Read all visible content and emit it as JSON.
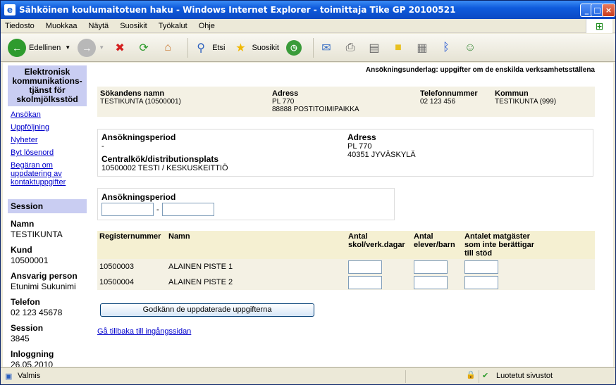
{
  "window": {
    "title": "Sähköinen koulumaitotuen haku - Windows Internet Explorer - toimittaja Tike GP 20100521"
  },
  "menu": [
    "Tiedosto",
    "Muokkaa",
    "Näytä",
    "Suosikit",
    "Työkalut",
    "Ohje"
  ],
  "toolbar": {
    "back": "Edellinen",
    "search": "Etsi",
    "favorites": "Suosikit"
  },
  "sidebar": {
    "heading": "Elektronisk kommunikations-tjänst för skolmjölksstöd",
    "links": [
      "Ansökan",
      "Uppföljning",
      "Nyheter",
      "Byt lösenord",
      "Begäran om uppdatering av kontaktuppgifter"
    ],
    "session_heading": "Session",
    "fields": [
      {
        "label": "Namn",
        "value": "TESTIKUNTA"
      },
      {
        "label": "Kund",
        "value": "10500001"
      },
      {
        "label": "Ansvarig person",
        "value": "Etunimi Sukunimi"
      },
      {
        "label": "Telefon",
        "value": "02 123 45678"
      },
      {
        "label": "Session",
        "value": "3845"
      },
      {
        "label": "Inloggning",
        "value": "26.05.2010"
      }
    ]
  },
  "main": {
    "topnote": "Ansökningsunderlag: uppgifter om de enskilda verksamhetsställena",
    "applicant": {
      "name_label": "Sökandens namn",
      "name": "TESTIKUNTA (10500001)",
      "addr_label": "Adress",
      "addr1": "PL 770",
      "addr2": "88888 POSTITOIMIPAIKKA",
      "phone_label": "Telefonnummer",
      "phone": "02 123 456",
      "muni_label": "Kommun",
      "muni": "TESTIKUNTA (999)"
    },
    "box2": {
      "period_label": "Ansökningsperiod",
      "period": "-",
      "kitchen_label": "Centralkök/distributionsplats",
      "kitchen": "10500002 TESTI / KESKUSKEITTIÖ",
      "addr_label": "Adress",
      "addr1": "PL 770",
      "addr2": "40351 JYVÄSKYLÄ"
    },
    "box3": {
      "period_label": "Ansökningsperiod",
      "dash": "-"
    },
    "table": {
      "headers": [
        "Registernummer",
        "Namn",
        "Antal skol/verk.dagar",
        "Antal elever/barn",
        "Antalet matgäster som inte berättigar till stöd"
      ],
      "rows": [
        {
          "reg": "10500003",
          "name": "ALAINEN PISTE 1"
        },
        {
          "reg": "10500004",
          "name": "ALAINEN PISTE 2"
        }
      ]
    },
    "submit": "Godkänn de uppdaterade uppgifterna",
    "back": "Gå tillbaka till ingångssidan"
  },
  "status": {
    "text": "Valmis",
    "zone": "Luotetut sivustot"
  }
}
